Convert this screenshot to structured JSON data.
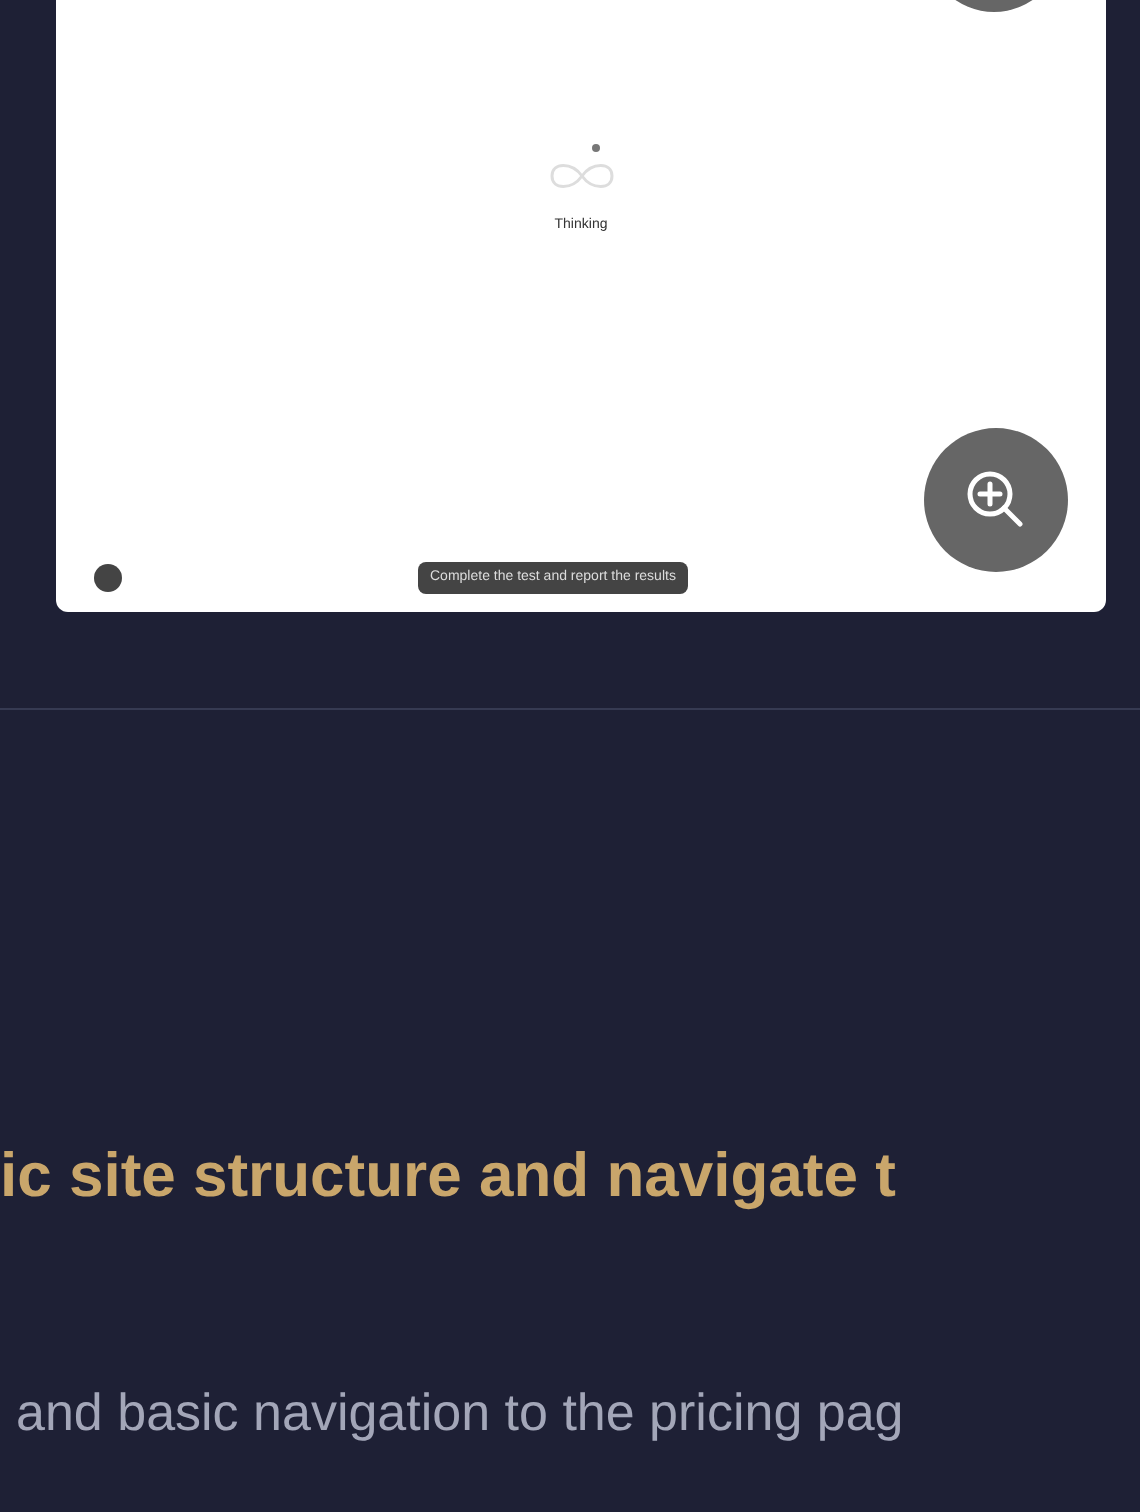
{
  "preview": {
    "loading_text": "Thinking",
    "tooltip": "Complete the test and report the results"
  },
  "heading": "ic site structure and navigate t",
  "subtitle": "and basic navigation to the pricing pag"
}
